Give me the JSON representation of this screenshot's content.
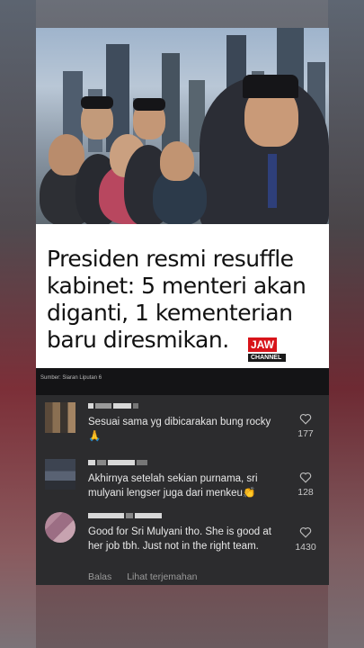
{
  "headline": "Presiden resmi resuffle kabinet: 5 menteri akan diganti, 1 kementerian baru diresmikan.",
  "logo": {
    "top_text": "JAW",
    "bottom_text": "CHANNEL",
    "badge": "NEWS"
  },
  "source": "Sumber: Siaran Liputan 6",
  "comments": [
    {
      "text": "Sesuai sama yg dibicarakan bung rocky 🙏",
      "likes": "177"
    },
    {
      "text": "Akhirnya setelah sekian purnama, sri mulyani lengser juga dari menkeu👏",
      "likes": "128"
    },
    {
      "text": "Good for Sri Mulyani tho. She is good at her job tbh. Just not in the right team.",
      "likes": "1430"
    }
  ],
  "actions": {
    "reply": "Balas",
    "translate": "Lihat terjemahan"
  },
  "icons": {
    "like": "heart-outline-icon"
  },
  "colors": {
    "logo_red": "#d8141a",
    "comment_bg": "#2c2c2e"
  }
}
